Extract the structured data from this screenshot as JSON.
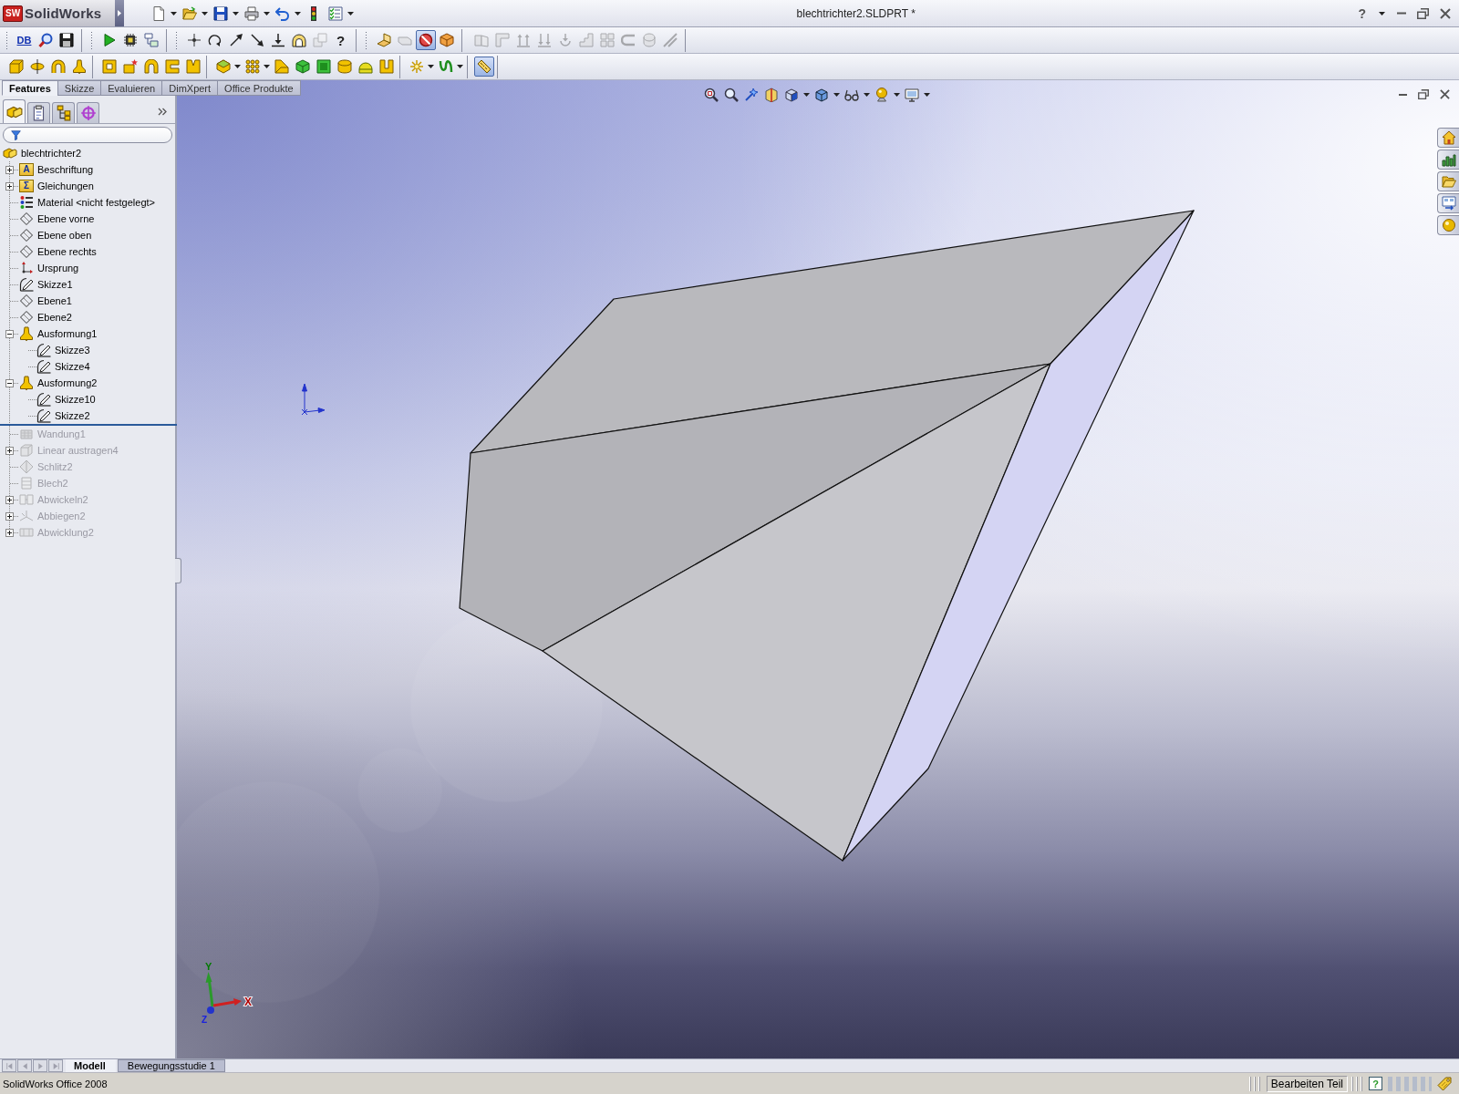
{
  "window": {
    "logo_badge": "SW",
    "app_name": "SolidWorks",
    "title": "blechtrichter2.SLDPRT *",
    "help": "?"
  },
  "quick_access": [
    {
      "kind": "page"
    },
    {
      "kind": "caret"
    },
    {
      "kind": "open"
    },
    {
      "kind": "caret"
    },
    {
      "kind": "save"
    },
    {
      "kind": "caret"
    },
    {
      "kind": "print"
    },
    {
      "kind": "caret"
    },
    {
      "kind": "undo"
    },
    {
      "kind": "caret"
    },
    {
      "kind": "rebuild"
    },
    {
      "kind": "options"
    },
    {
      "kind": "caret"
    }
  ],
  "toolbars": [
    {
      "groups": [
        {
          "kind": "handle",
          "buttons": [
            {
              "kind": "text",
              "label": "DB",
              "disabled": false,
              "pressed": false
            },
            {
              "kind": "magnifier",
              "disabled": false,
              "pressed": false
            },
            {
              "kind": "floppy-dark",
              "disabled": false,
              "pressed": false
            }
          ]
        },
        {
          "kind": "handle",
          "buttons": [
            {
              "kind": "play",
              "disabled": false,
              "pressed": false
            },
            {
              "kind": "chip",
              "disabled": false,
              "pressed": false
            },
            {
              "kind": "flowchart",
              "disabled": false,
              "pressed": false
            }
          ]
        },
        {
          "kind": "handle",
          "buttons": [
            {
              "kind": "sketch-point",
              "disabled": false,
              "pressed": false
            },
            {
              "kind": "arc-arrow",
              "disabled": false,
              "pressed": false
            },
            {
              "kind": "arrow-up-right",
              "disabled": false,
              "pressed": false
            },
            {
              "kind": "arrow-down-right",
              "disabled": false,
              "pressed": false
            },
            {
              "kind": "arrow-to-line",
              "disabled": false,
              "pressed": false
            },
            {
              "kind": "arch",
              "disabled": false,
              "pressed": false
            },
            {
              "kind": "stacked-squares",
              "disabled": true,
              "pressed": false
            },
            {
              "kind": "glyph",
              "label": "?",
              "disabled": false,
              "pressed": false
            }
          ]
        },
        {
          "kind": "handle",
          "buttons": [
            {
              "kind": "bent-sheet",
              "disabled": false,
              "pressed": false
            },
            {
              "kind": "sheet-tab",
              "disabled": true,
              "pressed": false
            },
            {
              "kind": "prohibition",
              "disabled": false,
              "pressed": true
            },
            {
              "kind": "open-cube",
              "disabled": false,
              "pressed": false
            }
          ]
        },
        {
          "kind": "section",
          "buttons": [
            {
              "kind": "folded-sheet",
              "disabled": true,
              "pressed": false
            },
            {
              "kind": "corner",
              "disabled": true,
              "pressed": false
            },
            {
              "kind": "up-arrows",
              "disabled": true,
              "pressed": false
            },
            {
              "kind": "down-arrows",
              "disabled": true,
              "pressed": false
            },
            {
              "kind": "hook-arrow",
              "disabled": true,
              "pressed": false
            },
            {
              "kind": "steps",
              "disabled": true,
              "pressed": false
            },
            {
              "kind": "grid",
              "disabled": true,
              "pressed": false
            },
            {
              "kind": "hem",
              "disabled": true,
              "pressed": false
            },
            {
              "kind": "rolled-sheet",
              "disabled": true,
              "pressed": false
            },
            {
              "kind": "slanted-lines",
              "disabled": true,
              "pressed": false
            }
          ]
        }
      ]
    },
    {
      "groups": [
        {
          "kind": "section",
          "buttons": [
            {
              "kind": "extrude-boss",
              "disabled": false,
              "pressed": false
            },
            {
              "kind": "revolve",
              "disabled": false,
              "pressed": false
            },
            {
              "kind": "sweep",
              "disabled": false,
              "pressed": false
            },
            {
              "kind": "loft",
              "disabled": false,
              "pressed": false
            }
          ]
        },
        {
          "kind": "section",
          "buttons": [
            {
              "kind": "frame",
              "disabled": false,
              "pressed": false
            },
            {
              "kind": "box-star",
              "disabled": false,
              "pressed": false
            },
            {
              "kind": "arch-block",
              "disabled": false,
              "pressed": false
            },
            {
              "kind": "c-block",
              "disabled": false,
              "pressed": false
            },
            {
              "kind": "notched-block",
              "disabled": false,
              "pressed": false
            }
          ]
        },
        {
          "kind": "section",
          "buttons": [
            {
              "kind": "hexagon",
              "disabled": false,
              "pressed": false
            },
            {
              "kind": "caret",
              "disabled": false,
              "pressed": false
            },
            {
              "kind": "dot-grid",
              "disabled": false,
              "pressed": false
            },
            {
              "kind": "caret",
              "disabled": false,
              "pressed": false
            },
            {
              "kind": "wedge",
              "disabled": false,
              "pressed": false
            },
            {
              "kind": "green-cube",
              "disabled": false,
              "pressed": false
            },
            {
              "kind": "green-block",
              "disabled": false,
              "pressed": false
            },
            {
              "kind": "cylinder",
              "disabled": false,
              "pressed": false
            },
            {
              "kind": "dome",
              "disabled": false,
              "pressed": false
            },
            {
              "kind": "u-block",
              "disabled": false,
              "pressed": false
            }
          ]
        },
        {
          "kind": "section",
          "buttons": [
            {
              "kind": "sparkle",
              "disabled": false,
              "pressed": false
            },
            {
              "kind": "caret",
              "disabled": false,
              "pressed": false
            },
            {
              "kind": "curve",
              "disabled": false,
              "pressed": false
            },
            {
              "kind": "caret",
              "disabled": false,
              "pressed": false
            }
          ]
        },
        {
          "kind": "section",
          "buttons": [
            {
              "kind": "ruler",
              "disabled": false,
              "pressed": true
            }
          ]
        }
      ]
    }
  ],
  "command_tabs": [
    {
      "label": "Features",
      "selected": true
    },
    {
      "label": "Skizze",
      "selected": false
    },
    {
      "label": "Evaluieren",
      "selected": false
    },
    {
      "label": "DimXpert",
      "selected": false
    },
    {
      "label": "Office Produkte",
      "selected": false
    }
  ],
  "panel_tabs": [
    {
      "kind": "feature-manager",
      "selected": true
    },
    {
      "kind": "property-manager",
      "selected": false
    },
    {
      "kind": "configuration-manager",
      "selected": false
    },
    {
      "kind": "dimxpert-manager",
      "selected": false
    }
  ],
  "feature_tree": {
    "root": {
      "label": "blechtrichter2",
      "kind": "part"
    },
    "items": [
      {
        "label": "Beschriftung",
        "kind": "folder",
        "icon_text": "A",
        "expanded": false,
        "rolled_back": false
      },
      {
        "label": "Gleichungen",
        "kind": "folder",
        "icon_text": "Σ",
        "expanded": false,
        "rolled_back": false
      },
      {
        "label": "Material <nicht festgelegt>",
        "kind": "material",
        "rolled_back": false
      },
      {
        "label": "Ebene vorne",
        "kind": "plane",
        "rolled_back": false
      },
      {
        "label": "Ebene oben",
        "kind": "plane",
        "rolled_back": false
      },
      {
        "label": "Ebene rechts",
        "kind": "plane",
        "rolled_back": false
      },
      {
        "label": "Ursprung",
        "kind": "origin",
        "rolled_back": false
      },
      {
        "label": "Skizze1",
        "kind": "sketch",
        "rolled_back": false
      },
      {
        "label": "Ebene1",
        "kind": "plane",
        "rolled_back": false
      },
      {
        "label": "Ebene2",
        "kind": "plane",
        "rolled_back": false
      },
      {
        "label": "Ausformung1",
        "kind": "loft",
        "expanded": true,
        "rolled_back": false,
        "children": [
          {
            "label": "Skizze3",
            "kind": "sketch",
            "rolled_back": false
          },
          {
            "label": "Skizze4",
            "kind": "sketch",
            "rolled_back": false
          }
        ]
      },
      {
        "label": "Ausformung2",
        "kind": "loft",
        "expanded": true,
        "rolled_back": false,
        "children": [
          {
            "label": "Skizze10",
            "kind": "sketch",
            "rolled_back": false
          },
          {
            "label": "Skizze2",
            "kind": "sketch",
            "rolled_back": false
          }
        ]
      },
      {
        "label": "Wandung1",
        "kind": "base-flange",
        "rolled_back": true
      },
      {
        "label": "Linear austragen4",
        "kind": "extrude",
        "expanded": false,
        "rolled_back": true
      },
      {
        "label": "Schlitz2",
        "kind": "rip",
        "rolled_back": true
      },
      {
        "label": "Blech2",
        "kind": "sheet-metal",
        "rolled_back": true
      },
      {
        "label": "Abwickeln2",
        "kind": "unfold",
        "expanded": false,
        "rolled_back": true
      },
      {
        "label": "Abbiegen2",
        "kind": "fold",
        "expanded": false,
        "rolled_back": true
      },
      {
        "label": "Abwicklung2",
        "kind": "flat-pattern",
        "expanded": false,
        "rolled_back": true
      }
    ]
  },
  "view_toolbar": [
    {
      "kind": "zoom-fit"
    },
    {
      "kind": "zoom-area"
    },
    {
      "kind": "previous-view"
    },
    {
      "kind": "section"
    },
    {
      "kind": "orientation"
    },
    {
      "kind": "caret"
    },
    {
      "kind": "display-style"
    },
    {
      "kind": "caret"
    },
    {
      "kind": "hide-show"
    },
    {
      "kind": "caret"
    },
    {
      "kind": "appearance"
    },
    {
      "kind": "caret"
    },
    {
      "kind": "scene"
    },
    {
      "kind": "caret"
    }
  ],
  "task_pane": [
    {
      "kind": "home"
    },
    {
      "kind": "library"
    },
    {
      "kind": "explorer"
    },
    {
      "kind": "view-palette"
    },
    {
      "kind": "appearances"
    }
  ],
  "triad": {
    "x_label": "X",
    "y_label": "Y",
    "z_label": "Z"
  },
  "bottom_bar": {
    "nav": [
      {
        "kind": "first",
        "disabled": true
      },
      {
        "kind": "previous",
        "disabled": true
      },
      {
        "kind": "next",
        "disabled": true
      },
      {
        "kind": "last",
        "disabled": true
      }
    ],
    "tabs": [
      {
        "label": "Modell",
        "selected": true
      },
      {
        "label": "Bewegungsstudie 1",
        "selected": false
      }
    ]
  },
  "status_bar": {
    "text": "SolidWorks Office 2008",
    "mode": "Bearbeiten Teil",
    "help": "?"
  }
}
